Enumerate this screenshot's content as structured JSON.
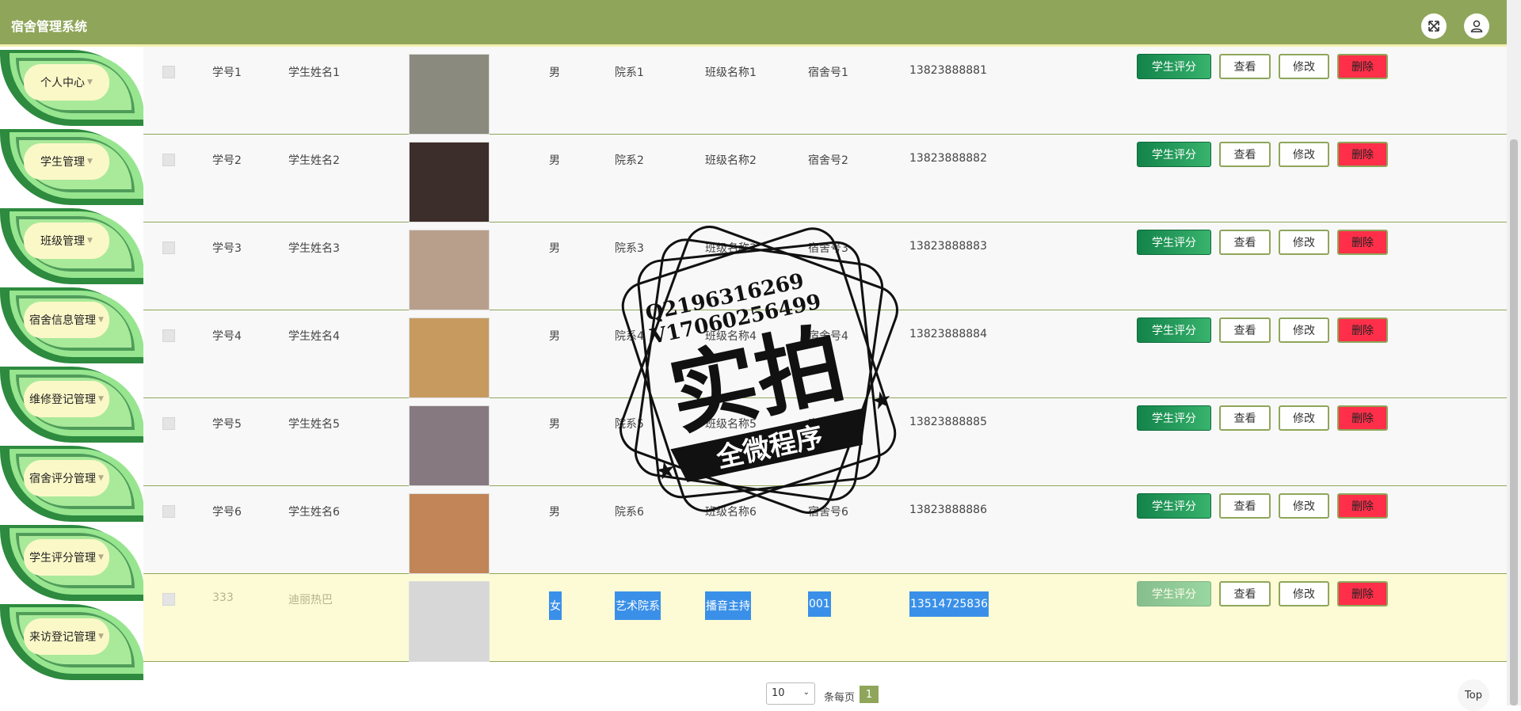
{
  "header": {
    "title": "宿舍管理系统",
    "fullscreen_icon": "expand-icon",
    "user_icon": "user-icon"
  },
  "sidebar": {
    "items": [
      {
        "label": "个人中心"
      },
      {
        "label": "学生管理"
      },
      {
        "label": "班级管理"
      },
      {
        "label": "宿舍信息管理"
      },
      {
        "label": "维修登记管理"
      },
      {
        "label": "宿舍评分管理"
      },
      {
        "label": "学生评分管理"
      },
      {
        "label": "来访登记管理"
      }
    ]
  },
  "table": {
    "rows": [
      {
        "id": "学号1",
        "name": "学生姓名1",
        "gender": "男",
        "dept": "院系1",
        "class": "班级名称1",
        "dorm": "宿舍号1",
        "phone": "13823888881",
        "avatar_color": "#8a8a7e"
      },
      {
        "id": "学号2",
        "name": "学生姓名2",
        "gender": "男",
        "dept": "院系2",
        "class": "班级名称2",
        "dorm": "宿舍号2",
        "phone": "13823888882",
        "avatar_color": "#3c2e2a"
      },
      {
        "id": "学号3",
        "name": "学生姓名3",
        "gender": "男",
        "dept": "院系3",
        "class": "班级名称3",
        "dorm": "宿舍号3",
        "phone": "13823888883",
        "avatar_color": "#b89f8c"
      },
      {
        "id": "学号4",
        "name": "学生姓名4",
        "gender": "男",
        "dept": "院系4",
        "class": "班级名称4",
        "dorm": "宿舍号4",
        "phone": "13823888884",
        "avatar_color": "#c79a60"
      },
      {
        "id": "学号5",
        "name": "学生姓名5",
        "gender": "男",
        "dept": "院系5",
        "class": "班级名称5",
        "dorm": "宿舍号5",
        "phone": "13823888885",
        "avatar_color": "#867a80"
      },
      {
        "id": "学号6",
        "name": "学生姓名6",
        "gender": "男",
        "dept": "院系6",
        "class": "班级名称6",
        "dorm": "宿舍号6",
        "phone": "13823888886",
        "avatar_color": "#c28558"
      },
      {
        "id": "333",
        "name": "迪丽热巴",
        "gender": "女",
        "dept": "艺术院系",
        "class": "播音主持",
        "dorm": "001",
        "phone": "13514725836",
        "avatar_color": "#d7d7d7"
      }
    ],
    "actions": {
      "rate": "学生评分",
      "view": "查看",
      "edit": "修改",
      "delete": "删除"
    },
    "highlight_row": 6
  },
  "pagination": {
    "page_size": "10",
    "per_page_label": "条每页",
    "current_page": "1",
    "top_label": "Top"
  },
  "watermark": {
    "line1": "Q2196316269",
    "line2": "V17060256499",
    "big": "实拍",
    "banner": "全微程序"
  }
}
